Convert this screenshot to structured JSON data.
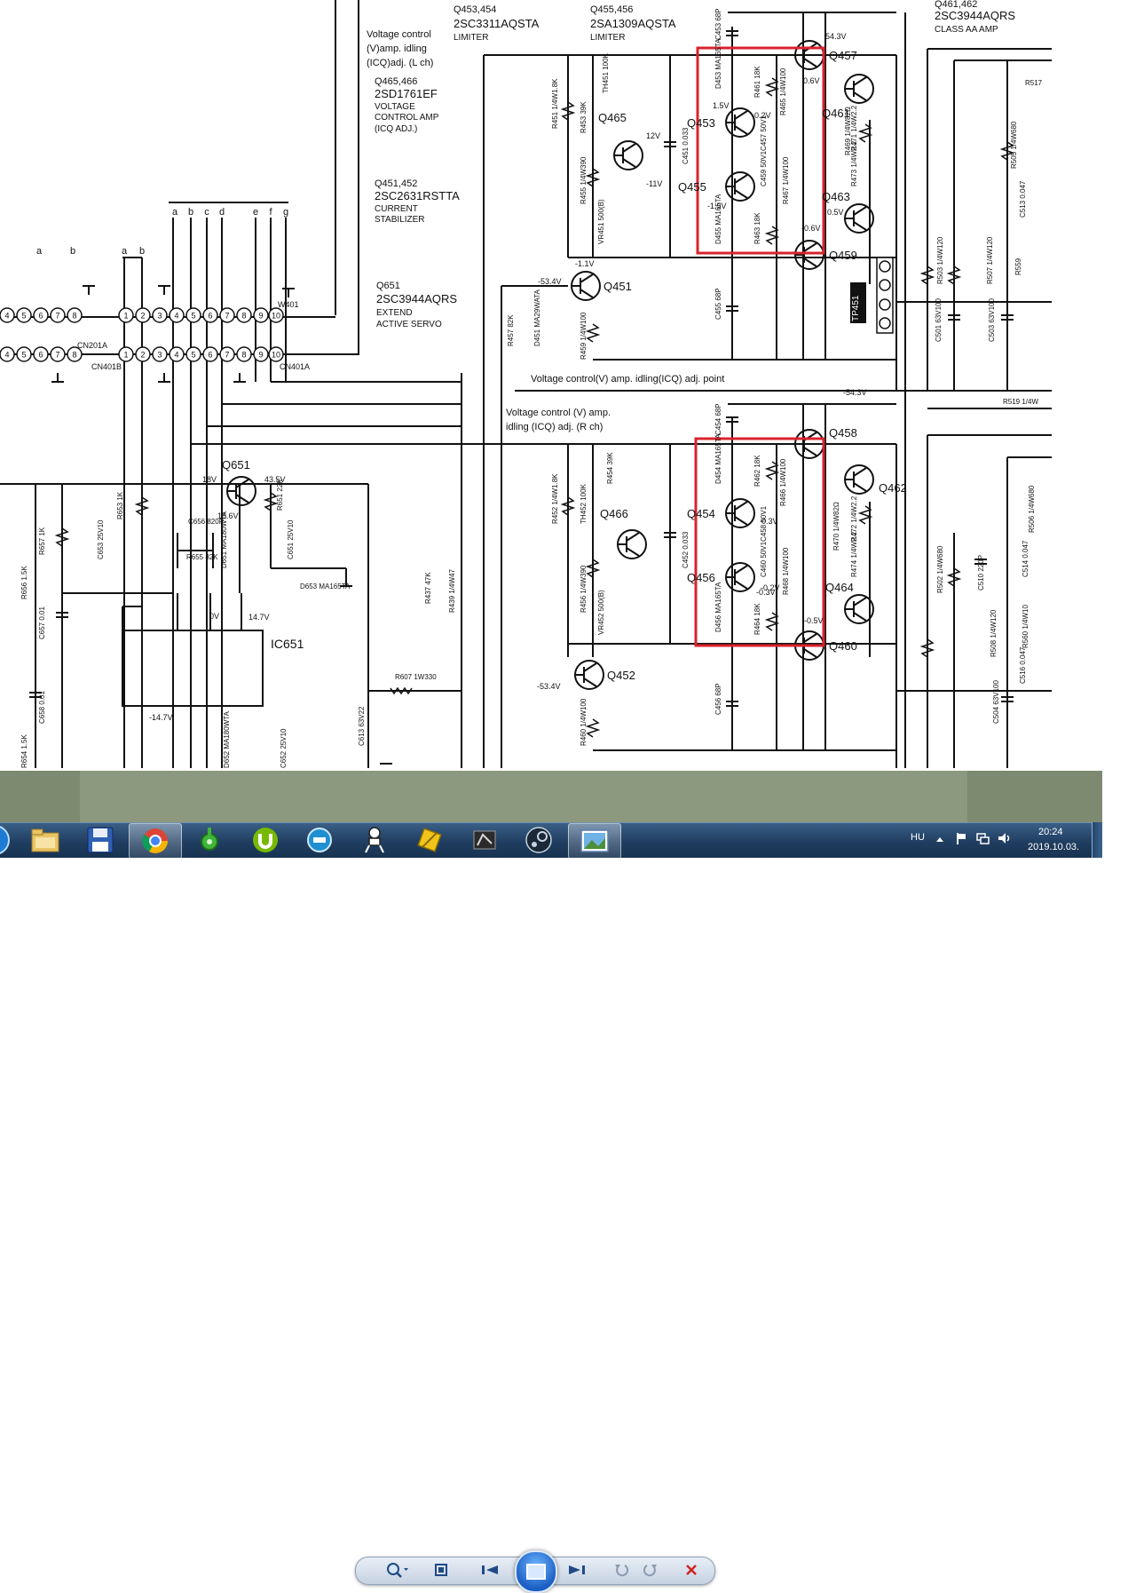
{
  "window": {
    "title": "Windows Photo Viewer"
  },
  "schematic": {
    "top_left_notes": [
      "Voltage control",
      "(V)amp. idling",
      "(ICQ)adj. (L ch)"
    ],
    "q465_466": {
      "ref": "Q465,466",
      "part": "2SD1761EF",
      "desc": [
        "VOLTAGE",
        "CONTROL AMP",
        "(ICQ ADJ.)"
      ]
    },
    "q451_452": {
      "ref": "Q451,452",
      "part": "2SC2631RSTTA",
      "desc": [
        "CURRENT",
        "STABILIZER"
      ]
    },
    "q651_desc": {
      "ref": "Q651",
      "part": "2SC3944AQRS",
      "desc": [
        "EXTEND",
        "ACTIVE SERVO"
      ]
    },
    "q453_454": {
      "ref": "Q453,454",
      "part": "2SC3311AQSTA",
      "desc": "LIMITER"
    },
    "q455_456": {
      "ref": "Q455,456",
      "part": "2SA1309AQSTA",
      "desc": "LIMITER"
    },
    "q461_462": {
      "ref": "Q461,462",
      "part": "2SC3944AQRS",
      "desc": "CLASS AA AMP"
    },
    "adj_point": "Voltage control(V) amp. idling(ICQ) adj. point",
    "r_ch_note": [
      "Voltage control (V) amp.",
      "idling (ICQ) adj. (R ch)"
    ],
    "transistors": [
      "Q457",
      "Q461",
      "Q453",
      "Q455",
      "Q463",
      "Q459",
      "Q465",
      "Q451",
      "Q458",
      "Q462",
      "Q454",
      "Q456",
      "Q464",
      "Q460",
      "Q466",
      "Q452",
      "Q651"
    ],
    "ic": "IC651",
    "connectors": [
      "CN201A",
      "CN401B",
      "CN401A",
      "W401"
    ],
    "bus_letters": [
      "a",
      "b",
      "a",
      "b",
      "a",
      "b",
      "c",
      "d",
      "e",
      "f",
      "g"
    ],
    "voltages": [
      "54.3V",
      "-54.3V",
      "0.6V",
      "-0.6V",
      "0.2V",
      "-0.2V",
      "1.5V",
      "-1.5V",
      "-1.1V",
      "-53.4V",
      "-53.4V",
      "12V",
      "-11V",
      "43.5V",
      "18V",
      "18.6V",
      "14.7V",
      "-14.7V",
      "0V",
      "-0.5V",
      "0.5V",
      "0.3V",
      "-0.3V"
    ],
    "test_point": "TP451",
    "components": [
      "R461 18K",
      "R465 1/4W100",
      "C457 50V1",
      "C459 50V1",
      "R467 1/4W100",
      "R463 18K",
      "D453 MA165TA",
      "D455 MA165TA",
      "C453 68P",
      "C455 68P",
      "R451 1/4W1.8K",
      "R453 39K",
      "TH451 100K",
      "R455 1/4W390",
      "VR451 500(B)",
      "C451 0.033",
      "R457 82K",
      "D451 MA29WATA",
      "R459 1/4W100",
      "R469 1/4W82Ω",
      "R471 1/4W2.2",
      "R473 1/4W2.2",
      "R503 1/4W120",
      "R507 1/4W120",
      "C501 63V100",
      "C503 63V100",
      "R505 1/4W680",
      "C513 0.047",
      "R559",
      "R519 1/4W",
      "R517",
      "R462 18K",
      "R466 1/4W100",
      "C458 50V1",
      "C460 50V1",
      "R468 1/4W100",
      "R464 18K",
      "D454 MA165TA",
      "D456 MA165TA",
      "C454 68P",
      "C456 68P",
      "R452 1/4W1.8K",
      "R454 39K",
      "TH452 100K",
      "R456 1/4W390",
      "VR452 500(B)",
      "C452 0.033",
      "R437 47K",
      "R439 1/4W47",
      "R460 1/4W100",
      "R470 1/4W82Ω",
      "R472 1/4W2.2",
      "R474 1/4W2.2",
      "R502 1/4W680",
      "C510 220P",
      "C514 0.047",
      "R506 1/4W680",
      "R508 1/4W120",
      "R560 1/4W10",
      "C516 0.047",
      "C504 63V100",
      "C656 820P",
      "R655 82K",
      "R653 1K",
      "R651 22K",
      "C653 25V10",
      "C651 25V10",
      "D651 MA180WTA",
      "D653 MA165TA",
      "R657 1K",
      "R656 1.5K",
      "C657 0.01",
      "C658 0.01",
      "R607 1W330",
      "C613 63V22",
      "D652 MA180WTA",
      "C652 25V10",
      "R654 1.5K"
    ]
  },
  "viewer_toolbar": {
    "buttons": [
      "zoom",
      "fit-to-window",
      "previous",
      "slideshow",
      "next",
      "rotate-counterclockwise",
      "rotate-clockwise",
      "delete"
    ]
  },
  "taskbar": {
    "apps": [
      "Start",
      "Windows Explorer",
      "Disk utility",
      "Google Chrome",
      "Network monitor",
      "uTorrent",
      "BlueStacks",
      "Keyboard shortcut app",
      "Archiver",
      "Corsair utility",
      "Steam",
      "Windows Photo Viewer"
    ],
    "language": "HU",
    "time": "20:24",
    "date": "2019.10.03."
  },
  "colors": {
    "highlight": "#d9232e",
    "ink": "#111111",
    "taskbar": "#1f3d60"
  }
}
